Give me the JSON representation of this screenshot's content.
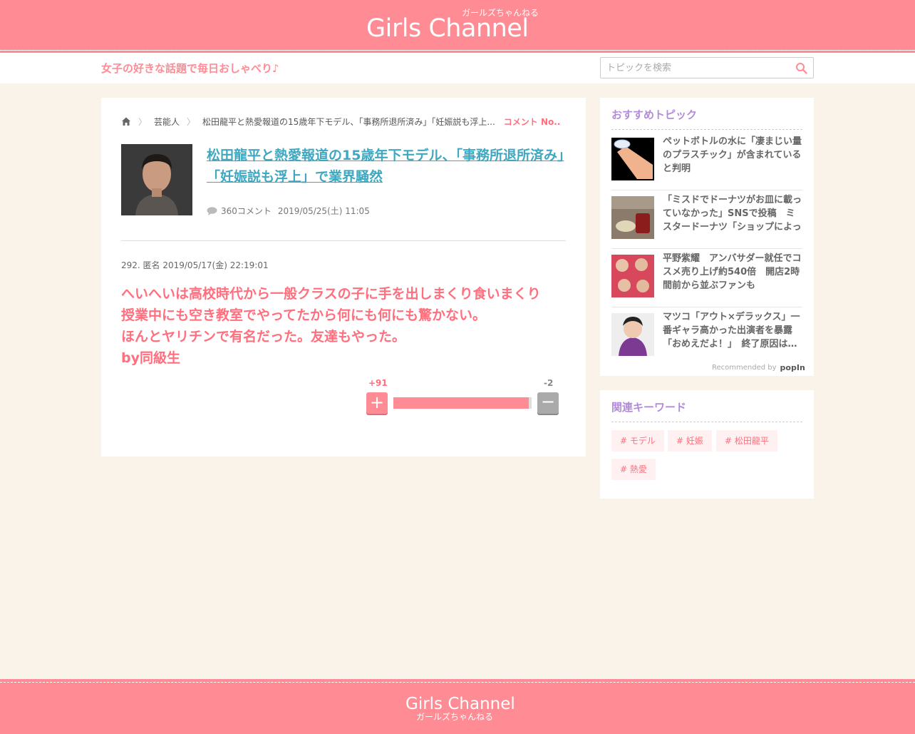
{
  "header": {
    "logo": "Girls Channel",
    "logo_sub": "ガールズちゃんねる",
    "tagline": "女子の好きな話題で毎日おしゃべり♪"
  },
  "search": {
    "placeholder": "トピックを検索",
    "icon": "search-icon"
  },
  "breadcrumb": {
    "home_icon": "home-icon",
    "category": "芸能人",
    "topic": "松田龍平と熱愛報道の15歳年下モデル、「事務所退所済み」「妊娠説も浮上...",
    "current": "コメント No..."
  },
  "topic": {
    "title": "松田龍平と熱愛報道の15歳年下モデル、「事務所退所済み」「妊娠説も浮上」で業界騒然",
    "comments": "360コメント",
    "date": "2019/05/25(土) 11:05"
  },
  "comment": {
    "header": "292. 匿名 2019/05/17(金) 22:19:01",
    "body": "へいへいは高校時代から一般クラスの子に手を出しまくり食いまくり\n授業中にも空き教室でやってたから何にも何にも驚かない。\nほんとヤリチンで有名だった。友達もやった。\nby同級生",
    "plus_count": "+91",
    "minus_count": "-2",
    "plus_label": "+",
    "minus_label": "−",
    "plus_ratio": 0.978
  },
  "recommended": {
    "title": "おすすめトピック",
    "items": [
      {
        "text": "ペットボトルの水に「凄まじい量のプラスチック」が含まれていると判明"
      },
      {
        "text": "「ミスドでドーナツがお皿に載っていなかった」SNSで投稿　ミスタードーナツ「ショップによって異なります」"
      },
      {
        "text": "平野紫耀　アンバサダー就任でコスメ売り上げ約540倍　開店2時間前から並ぶファンも"
      },
      {
        "text": "マツコ「アウト×デラックス」一番ギャラ高かった出演者を暴露「おめえだよ！」　終了原因は…"
      }
    ],
    "recommended_by": "Recommended by",
    "popin": "popIn"
  },
  "keywords": {
    "title": "関連キーワード",
    "tags": [
      "# モデル",
      "# 妊娠",
      "# 松田龍平",
      "# 熱愛"
    ]
  },
  "footer": {
    "logo": "Girls Channel",
    "logo_sub": "ガールズちゃんねる"
  },
  "colors": {
    "accent": "#ff8b95",
    "link": "#3fa8c0",
    "side_title": "#b38cd9",
    "background": "#faf3ea"
  }
}
